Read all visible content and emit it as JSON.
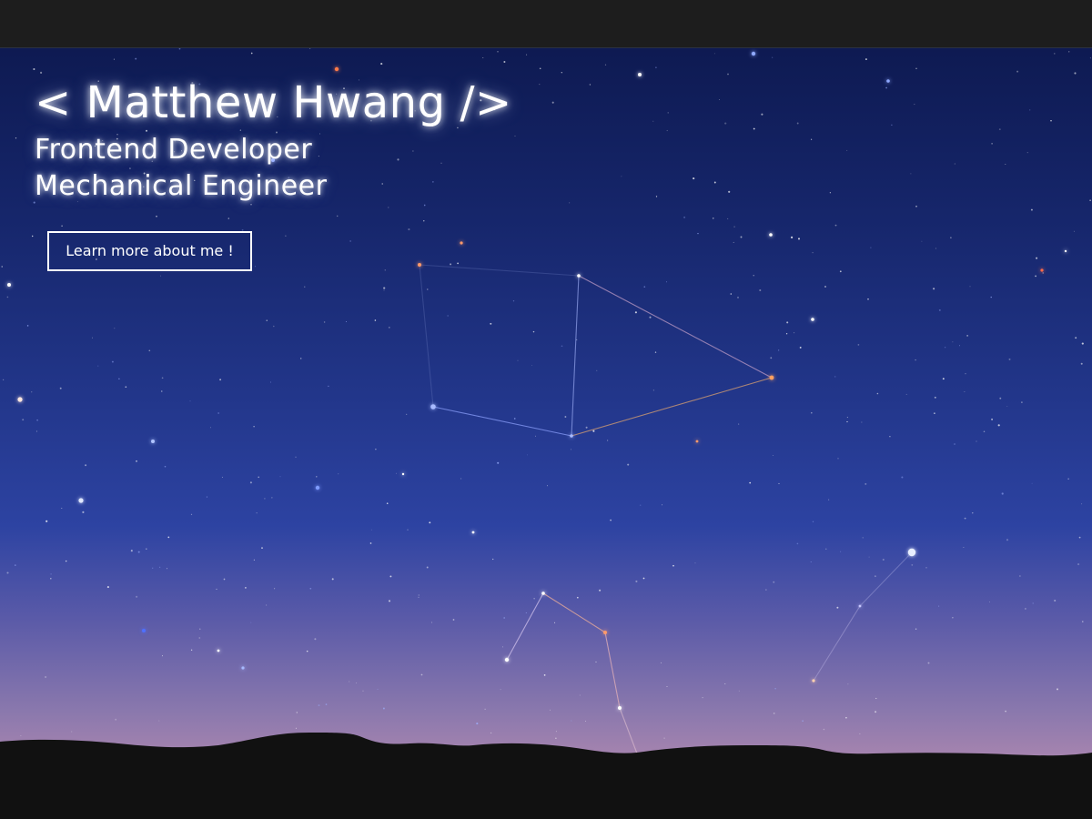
{
  "header": {
    "background": "#1d1d1d"
  },
  "hero": {
    "name": "< Matthew Hwang />",
    "roles": [
      "Frontend Developer",
      "Mechanical Engineer"
    ],
    "cta_label": "Learn more about me !"
  },
  "colors": {
    "sky_top": "#0e1a52",
    "sky_mid": "#2d43a2",
    "sky_horizon": "#c196b2",
    "ground": "#111111",
    "text": "#ffffff"
  },
  "icons": {
    "background": "starry-night-sky-with-constellations",
    "foreground": "mountain-silhouette"
  }
}
